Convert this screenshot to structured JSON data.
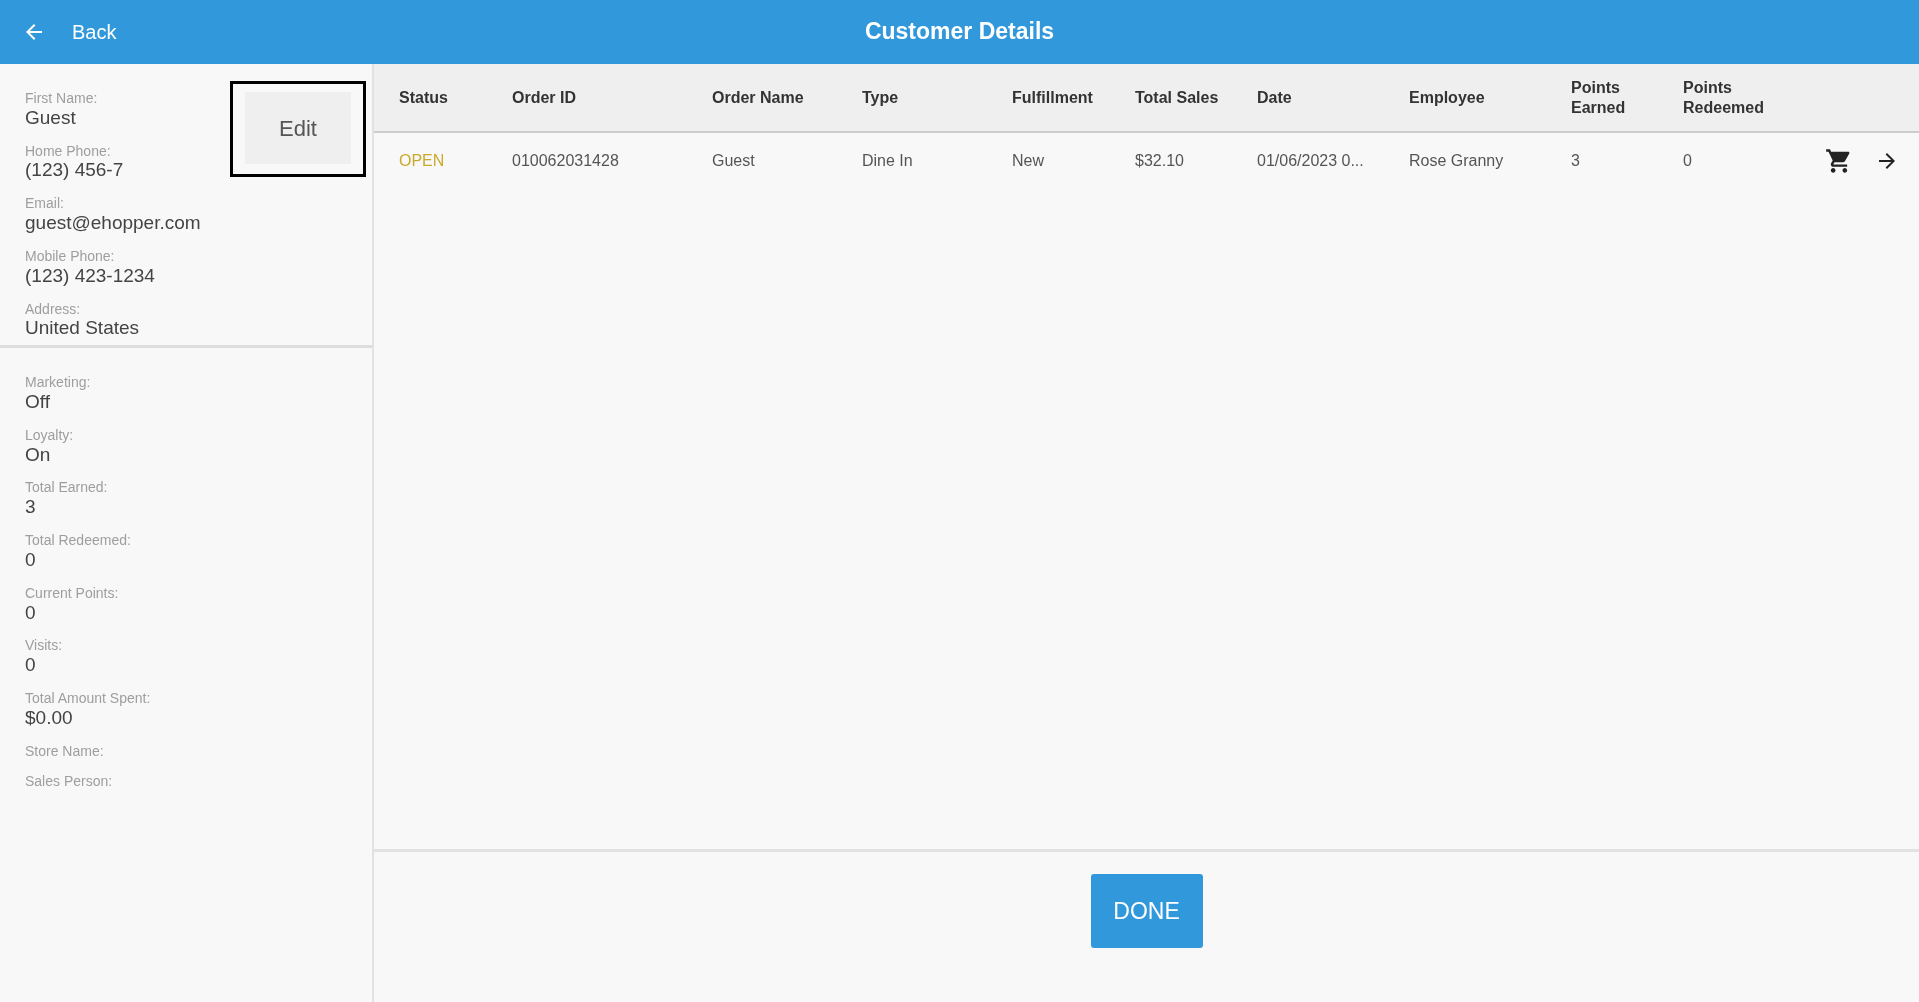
{
  "header": {
    "back": "Back",
    "title": "Customer Details"
  },
  "edit_button": {
    "label": "Edit",
    "focused": true
  },
  "customer_groups": [
    [
      {
        "label": "First Name:",
        "value": "Guest"
      },
      {
        "label": "Home Phone:",
        "value": "(123) 456-7"
      },
      {
        "label": "Email:",
        "value": "guest@ehopper.com"
      },
      {
        "label": "Mobile Phone:",
        "value": "(123) 423-1234"
      },
      {
        "label": "Address:",
        "value": "United States"
      }
    ],
    [
      {
        "label": "Marketing:",
        "value": "Off"
      },
      {
        "label": "Loyalty:",
        "value": "On"
      },
      {
        "label": "Total Earned:",
        "value": "3"
      },
      {
        "label": "Total Redeemed:",
        "value": "0"
      },
      {
        "label": "Current Points:",
        "value": "0"
      },
      {
        "label": "Visits:",
        "value": "0"
      },
      {
        "label": "Total Amount Spent:",
        "value": "$0.00"
      },
      {
        "label": "Store Name:"
      },
      {
        "label": "Sales Person:"
      }
    ]
  ],
  "orders": {
    "columns": [
      "Status",
      "Order ID",
      "Order Name",
      "Type",
      "Fulfillment",
      "Total Sales",
      "Date",
      "Employee",
      "Points Earned",
      "Points Redeemed"
    ],
    "rows": [
      {
        "color": "#c8aa2c",
        "cells": [
          "OPEN",
          "010062031428",
          "Guest",
          "Dine In",
          "New",
          "$32.10",
          "01/06/2023 0...",
          "Rose Granny",
          "3",
          "0"
        ]
      }
    ]
  },
  "done_button": "DONE"
}
